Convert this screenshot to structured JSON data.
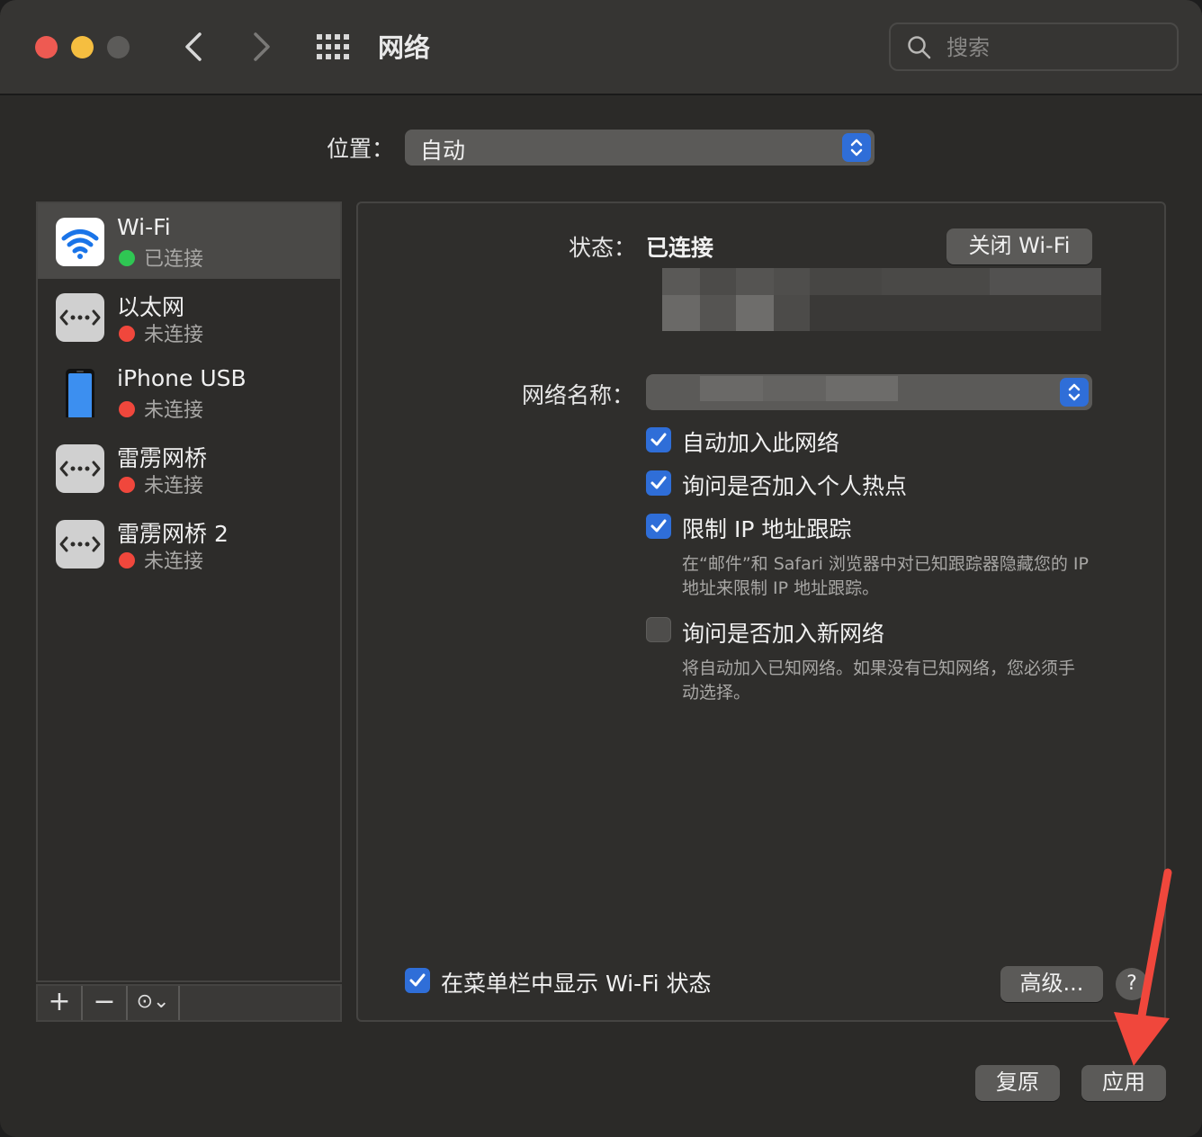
{
  "window": {
    "title": "网络",
    "search_placeholder": "搜索"
  },
  "location": {
    "label": "位置：",
    "value": "自动"
  },
  "services": [
    {
      "name": "Wi-Fi",
      "status": "已连接",
      "status_color": "#2fc653",
      "icon": "wifi-icon",
      "selected": true
    },
    {
      "name": "以太网",
      "status": "未连接",
      "status_color": "#f0473c",
      "icon": "ethernet-icon"
    },
    {
      "name": "iPhone USB",
      "status": "未连接",
      "status_color": "#f0473c",
      "icon": "iphone-icon"
    },
    {
      "name": "雷雳网桥",
      "status": "未连接",
      "status_color": "#f0473c",
      "icon": "ethernet-icon"
    },
    {
      "name": "雷雳网桥 2",
      "status": "未连接",
      "status_color": "#f0473c",
      "icon": "ethernet-icon"
    }
  ],
  "sidebar_tools": {
    "add": "+",
    "remove": "−",
    "more": "⊙⌄"
  },
  "detail": {
    "status_label": "状态：",
    "status_value": "已连接",
    "toggle_wifi_button": "关闭 Wi-Fi",
    "network_name_label": "网络名称：",
    "network_name_value": "",
    "options": [
      {
        "label": "自动加入此网络",
        "checked": true
      },
      {
        "label": "询问是否加入个人热点",
        "checked": true
      },
      {
        "label": "限制 IP 地址跟踪",
        "checked": true
      },
      {
        "label": "询问是否加入新网络",
        "checked": false
      }
    ],
    "ip_tracking_note_line1": "在“邮件”和 Safari 浏览器中对已知跟踪器隐藏您的 IP",
    "ip_tracking_note_line2": "地址来限制 IP 地址跟踪。",
    "new_network_note_line1": "将自动加入已知网络。如果没有已知网络，您必须手",
    "new_network_note_line2": "动选择。",
    "menubar_option": "在菜单栏中显示 Wi-Fi 状态",
    "advanced_button": "高级...",
    "help_button": "?"
  },
  "footer": {
    "revert_button": "复原",
    "apply_button": "应用"
  },
  "colors": {
    "accent": "#2f6ed8",
    "annotation_arrow": "#f0473c"
  }
}
